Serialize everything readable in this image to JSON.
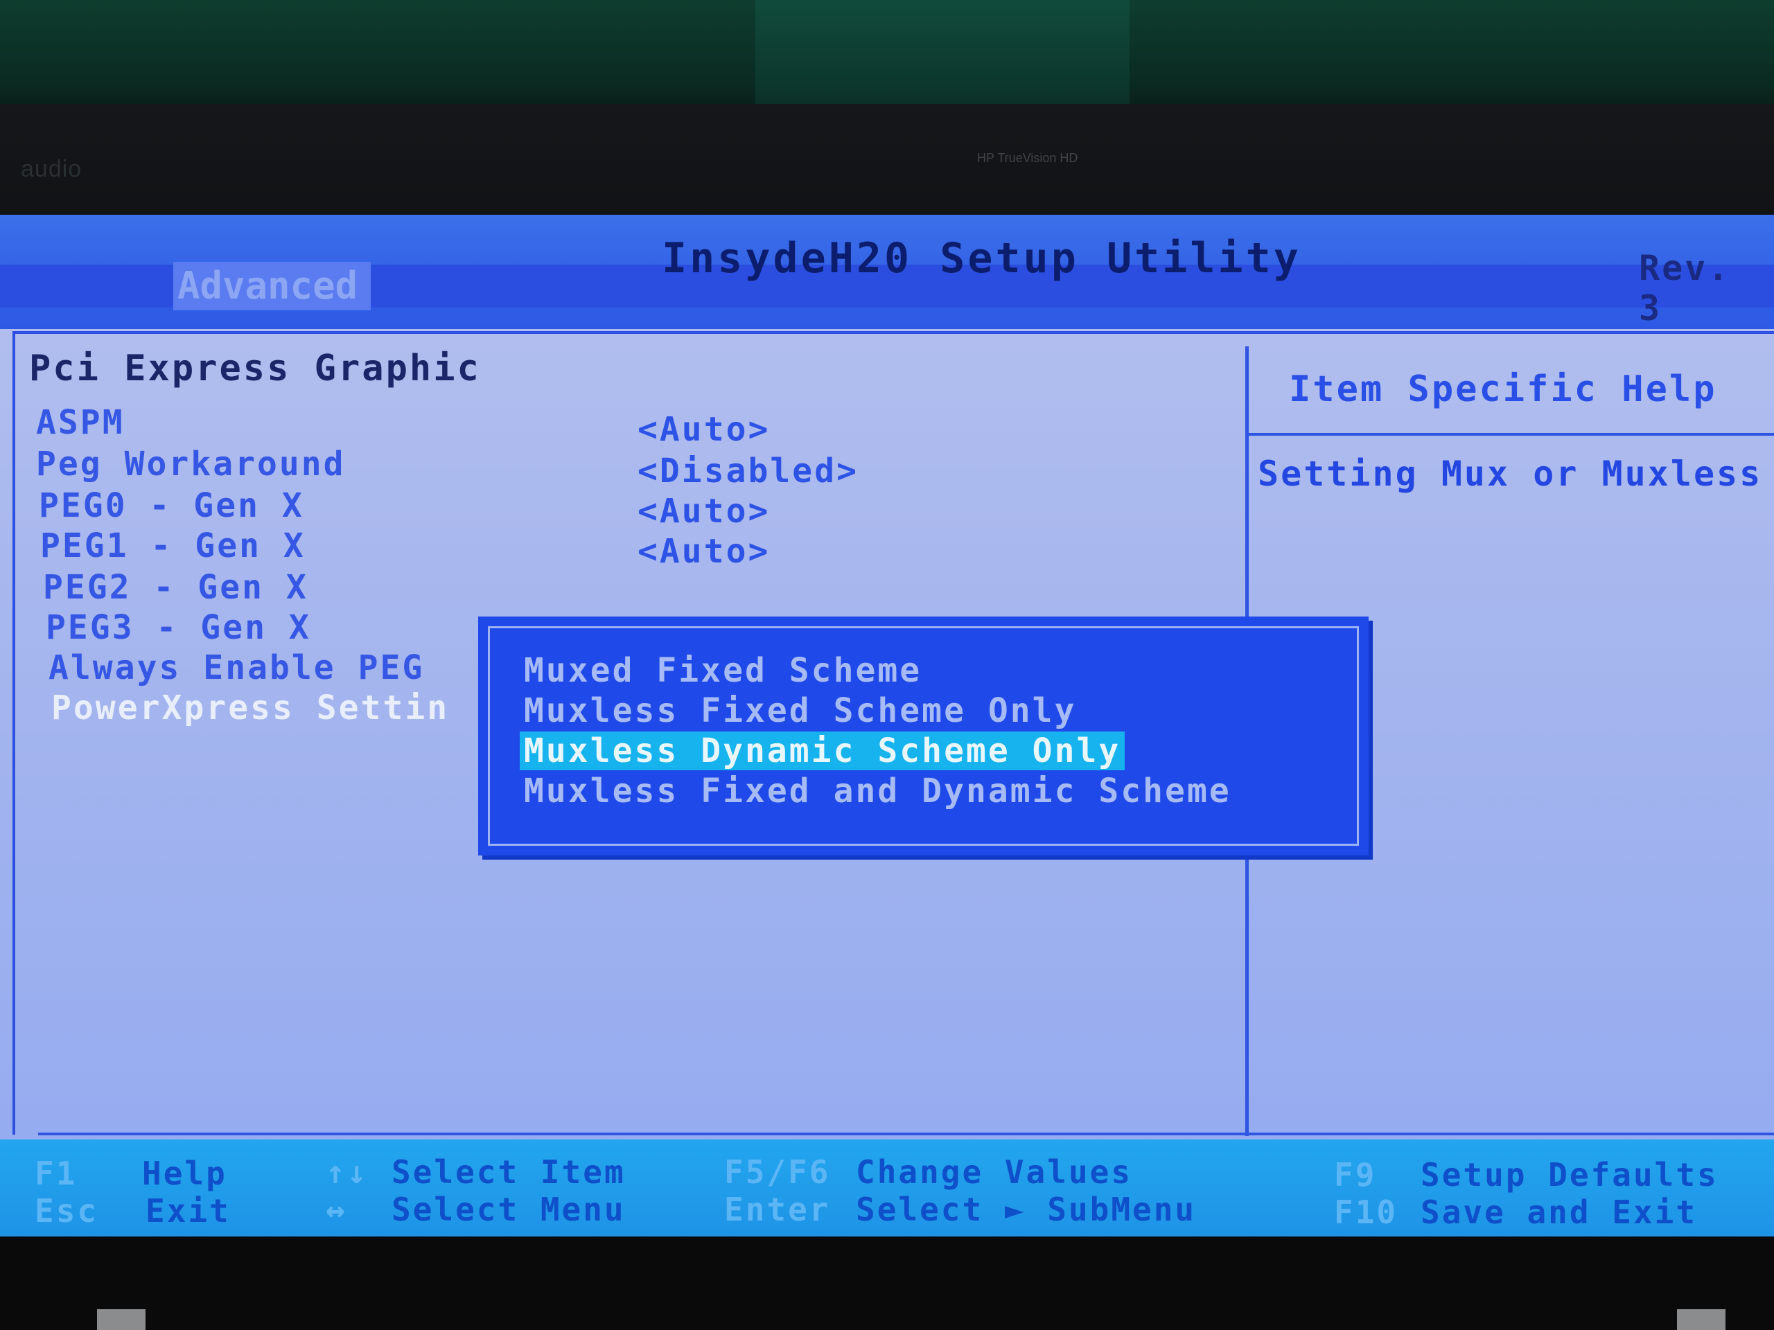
{
  "bezel": {
    "audio_label": "audio",
    "camera_label": "HP TrueVision HD"
  },
  "header": {
    "title": "InsydeH20 Setup Utility",
    "revision": "Rev. 3",
    "active_tab": "Advanced"
  },
  "page": {
    "section_title": "Pci Express Graphic"
  },
  "settings": [
    {
      "label": "ASPM",
      "value": "<Auto>"
    },
    {
      "label": "Peg Workaround",
      "value": "<Disabled>"
    },
    {
      "label": "PEG0 - Gen X",
      "value": "<Auto>"
    },
    {
      "label": "PEG1 - Gen X",
      "value": "<Auto>"
    },
    {
      "label": "PEG2 - Gen X",
      "value": ""
    },
    {
      "label": "PEG3 - Gen X",
      "value": ""
    },
    {
      "label": "Always Enable PEG",
      "value": ""
    },
    {
      "label": "PowerXpress Settin",
      "value": ""
    }
  ],
  "help": {
    "title": "Item Specific Help",
    "text": "Setting Mux or Muxless"
  },
  "popup": {
    "options": [
      "Muxed Fixed Scheme",
      "Muxless Fixed Scheme Only",
      "Muxless Dynamic Scheme Only",
      "Muxless Fixed and Dynamic Scheme"
    ],
    "selected_index": 2
  },
  "footer": {
    "row1": [
      {
        "key": "F1",
        "action": "Help"
      },
      {
        "key": "↑↓",
        "action": "Select Item"
      },
      {
        "key": "F5/F6",
        "action": "Change Values"
      },
      {
        "key": "F9",
        "action": "Setup Defaults"
      }
    ],
    "row2": [
      {
        "key": "Esc",
        "action": "Exit"
      },
      {
        "key": "↔",
        "action": "Select Menu"
      },
      {
        "key": "Enter",
        "action": "Select ► SubMenu"
      },
      {
        "key": "F10",
        "action": "Save and Exit"
      }
    ]
  },
  "colors": {
    "screen_bg": "#a6b6ee",
    "title_bar": "#2d58e4",
    "popup_bg": "#1f49e8",
    "highlight": "#16b3ee",
    "footer_bg": "#1e93e6"
  }
}
